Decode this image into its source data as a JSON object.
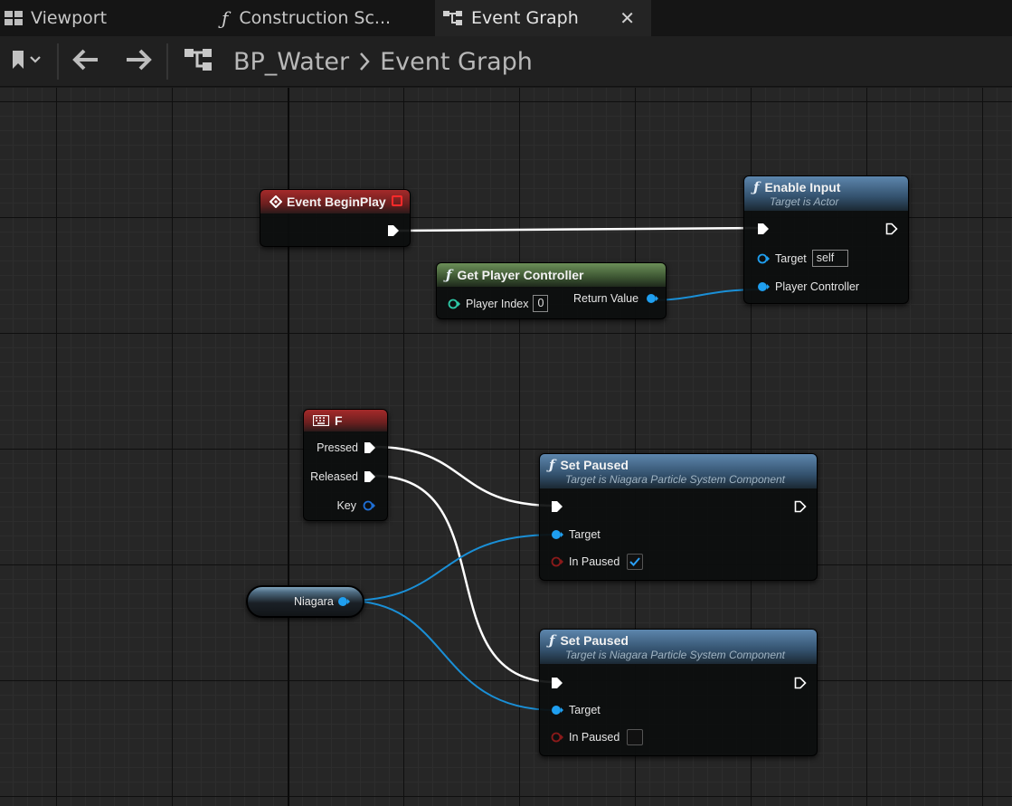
{
  "tabs": [
    {
      "label": "Viewport",
      "icon": "viewport-icon",
      "active": false
    },
    {
      "label": "Construction Sc...",
      "icon": "function-icon",
      "active": false
    },
    {
      "label": "Event Graph",
      "icon": "event-graph-icon",
      "active": true
    }
  ],
  "toolbar": {
    "breadcrumb_blueprint": "BP_Water",
    "breadcrumb_graph": "Event Graph"
  },
  "nodes": {
    "begin_play": {
      "title": "Event BeginPlay"
    },
    "enable_input": {
      "title": "Enable Input",
      "subtitle": "Target is Actor",
      "target_label": "Target",
      "target_value": "self",
      "player_controller_label": "Player Controller"
    },
    "get_player_controller": {
      "title": "Get Player Controller",
      "player_index_label": "Player Index",
      "player_index_value": "0",
      "return_value_label": "Return Value"
    },
    "key_f": {
      "title": "F",
      "pressed_label": "Pressed",
      "released_label": "Released",
      "key_label": "Key"
    },
    "set_paused_1": {
      "title": "Set Paused",
      "subtitle": "Target is Niagara Particle System Component",
      "target_label": "Target",
      "in_paused_label": "In Paused",
      "in_paused_checked": true
    },
    "set_paused_2": {
      "title": "Set Paused",
      "subtitle": "Target is Niagara Particle System Component",
      "target_label": "Target",
      "in_paused_label": "In Paused",
      "in_paused_checked": false
    },
    "niagara_var": {
      "label": "Niagara"
    }
  },
  "colors": {
    "exec_wire": "#ffffff",
    "object_wire": "#1a8fd6",
    "object_pin": "#1f9ff0",
    "bool_pin": "#8b1a1a",
    "int_pin": "#2ec9a7"
  }
}
